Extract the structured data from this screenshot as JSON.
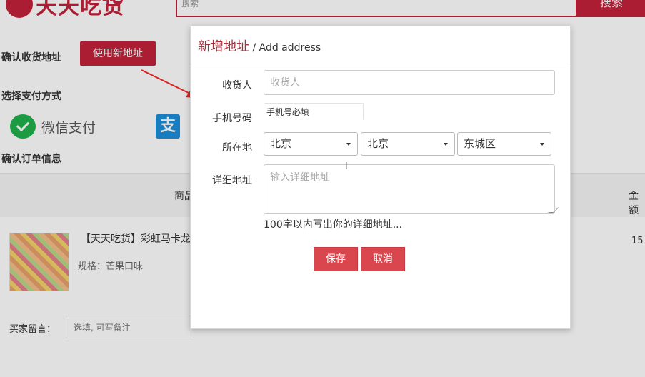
{
  "page": {
    "logo_text": "天天吃货",
    "search_placeholder": "搜索",
    "search_button": "搜索",
    "confirm_address_title": "确认收货地址",
    "use_new_address_button": "使用新地址",
    "payment_title": "选择支付方式",
    "wechat_pay_label": "微信支付",
    "alipay_icon_char": "支",
    "order_info_title": "确认订单信息",
    "table_header_goods": "商品",
    "table_header_amount": "金额",
    "product_name": "【天天吃货】彩虹马卡龙",
    "product_spec": "规格：芒果口味",
    "product_amount": "15",
    "buyer_message_label": "买家留言：",
    "buyer_message_placeholder": "选填, 可写备注"
  },
  "modal": {
    "title_cn": "新增地址",
    "title_en": " / Add address",
    "receiver_label": "收货人",
    "receiver_placeholder": "收货人",
    "phone_label": "手机号码",
    "phone_placeholder": "手机号必填",
    "location_label": "所在地",
    "province_value": "北京",
    "city_value": "北京",
    "district_value": "东城区",
    "detail_label": "详细地址",
    "detail_placeholder": "输入详细地址",
    "help_text": "100字以内写出你的详细地址...",
    "save_button": "保存",
    "cancel_button": "取消"
  },
  "colors": {
    "brand": "#c2213a",
    "title_accent": "#a2323e",
    "button_red": "#d9464e",
    "wechat_green": "#22b14c",
    "alipay_blue": "#1c8fdb"
  }
}
